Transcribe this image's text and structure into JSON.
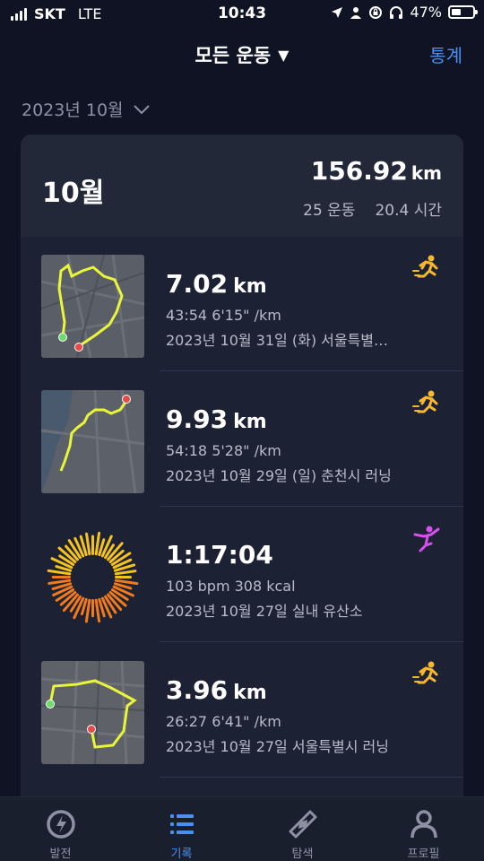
{
  "status_bar": {
    "carrier": "SKT",
    "network": "LTE",
    "time": "10:43",
    "battery_percent_text": "47%",
    "battery_level": 0.47
  },
  "header": {
    "filter_label": "모든 운동",
    "stats_label": "통계"
  },
  "month_selector": {
    "label": "2023년 10월"
  },
  "summary": {
    "month": "10월",
    "distance": "156.92",
    "distance_unit": "km",
    "workouts": "25 운동",
    "duration": "20.4 시간"
  },
  "activities": [
    {
      "main": "7.02",
      "unit": "km",
      "line2": "43:54  6'15\" /km",
      "line3": "2023년 10월 31일 (화) 서울특별…",
      "icon": "running-icon",
      "thumb": "map"
    },
    {
      "main": "9.93",
      "unit": "km",
      "line2": "54:18  5'28\" /km",
      "line3": "2023년 10월 29일 (일) 춘천시 러닝",
      "icon": "running-icon",
      "thumb": "map"
    },
    {
      "main": "1:17:04",
      "unit": "",
      "line2": "103 bpm  308 kcal",
      "line3": "2023년 10월 27일 실내 유산소",
      "icon": "yoga-icon",
      "thumb": "heart-rate-ring"
    },
    {
      "main": "3.96",
      "unit": "km",
      "line2": "26:27  6'41\" /km",
      "line3": "2023년 10월 27일 서울특별시 러닝",
      "icon": "running-icon",
      "thumb": "map"
    }
  ],
  "tab_bar": {
    "tabs": [
      {
        "label": "발전",
        "icon": "progress-icon"
      },
      {
        "label": "기록",
        "icon": "list-icon",
        "active": true
      },
      {
        "label": "탐색",
        "icon": "compass-icon"
      },
      {
        "label": "프로필",
        "icon": "profile-icon"
      }
    ]
  },
  "colors": {
    "background": "#0f1324",
    "card": "#1c2134",
    "accent": "#4a90f0",
    "route": "#e9f53b",
    "running": "#f5b82e",
    "yoga": "#d84ff0"
  }
}
